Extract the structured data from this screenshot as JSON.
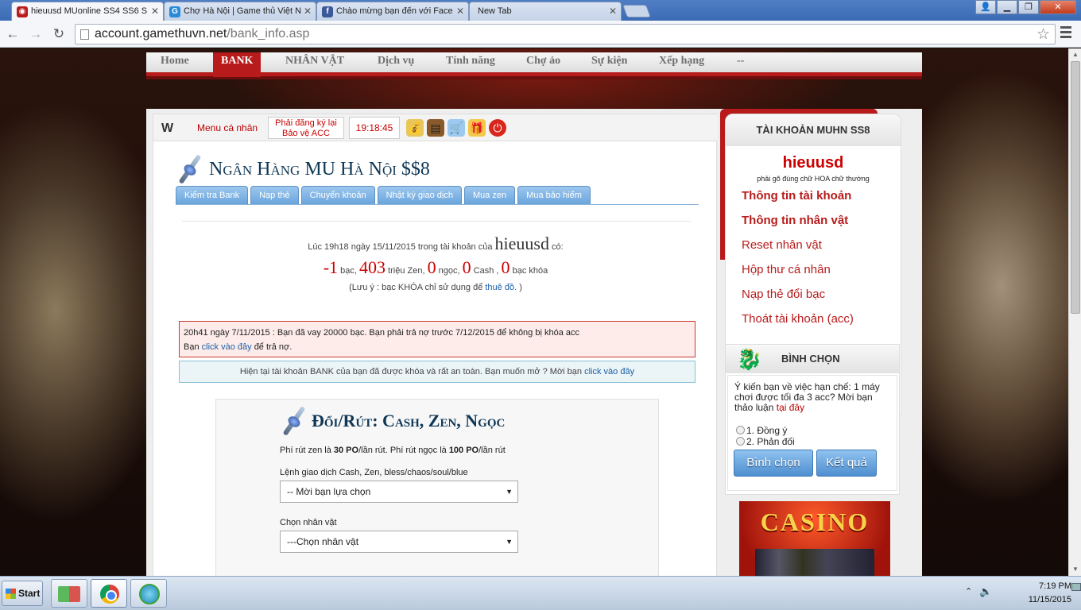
{
  "browser": {
    "tabs": [
      {
        "title": "hieuusd MUonline SS4 SS6 S",
        "icon": "mu-favicon",
        "color": "#b81b1b"
      },
      {
        "title": "Chợ Hà Nội | Game thủ Việt N",
        "icon": "g-favicon",
        "color": "#2a8ad8"
      },
      {
        "title": "Chào mừng bạn đến với Face",
        "icon": "facebook-favicon",
        "color": "#3b5998"
      },
      {
        "title": "New Tab",
        "icon": "",
        "color": ""
      }
    ],
    "url_host": "account.gamethuvn.net",
    "url_path": "/bank_info.asp"
  },
  "topnav": {
    "items": [
      "Home",
      "BANK",
      "NHÂN VẬT",
      "Dịch vụ",
      "Tính năng",
      "Chợ ảo",
      "Sự kiện",
      "Xếp hạng",
      "--"
    ],
    "active": "BANK"
  },
  "subbar": {
    "logo": "W",
    "menu_label": "Menu cá nhân",
    "register_line1": "Phải đăng ký lại",
    "register_line2": "Bảo vệ ACC",
    "clock": "19:18:45",
    "icons": [
      "money-bag-icon",
      "treasure-chest-icon",
      "cart-icon",
      "gift-icon",
      "power-icon"
    ]
  },
  "bank": {
    "title": "Ngân Hàng MU Hà Nội $$8",
    "tabs": [
      "Kiểm tra Bank",
      "Nạp thẻ",
      "Chuyển khoản",
      "Nhật ký giao dịch",
      "Mua zen",
      "Mua bảo hiểm"
    ],
    "account_prefix": "Lúc 19h18 ngày 15/11/2015 trong tài khoản của",
    "account_name": "hieuusd",
    "account_suffix": "có:",
    "balance": {
      "bac": "-1",
      "bac_label": "bạc,",
      "zen": "403",
      "zen_label": "triệu Zen,",
      "ngoc": "0",
      "ngoc_label": "ngọc,",
      "cash": "0",
      "cash_label": "Cash ,",
      "bac_khoa": "0",
      "bac_khoa_label": "bạc khóa"
    },
    "note_prefix": "(Lưu ý : bạc KHÓA chỉ sử dụng để",
    "note_link": "thuê đồ.",
    "note_suffix": ")",
    "warning_line1": "20h41 ngày 7/11/2015 : Bạn đã vay 20000 bạc. Bạn phải trả nợ trước 7/12/2015 để không bị khóa acc",
    "warning_prefix": "Bạn",
    "warning_link": "click vào đây",
    "warning_suffix": "để trả nợ.",
    "info_text": "Hiện tại tài khoản BANK của bạn đã được khóa và rất an toàn. Bạn muốn mở ? Mời bạn",
    "info_link": "click vào đây"
  },
  "withdraw": {
    "title": "Đổi/Rút: Cash, Zen, Ngọc",
    "fee_prefix": "Phí rút zen là",
    "fee_zen": "30 PO",
    "fee_mid": "/lần rút. Phí rút ngọc là",
    "fee_ngoc": "100 PO",
    "fee_suffix": "/lần rút",
    "command_label": "Lệnh giao dịch Cash, Zen, bless/chaos/soul/blue",
    "command_value": "-- Mời bạn lựa chọn",
    "char_label": "Chọn nhân vật",
    "char_value": "---Chọn nhân vật"
  },
  "sidebar": {
    "title": "TÀI KHOẢN MUHN SS8",
    "username": "hieuusd",
    "hint": "phải gõ đúng chữ HOA chữ thường",
    "links": [
      "Thông tin tài khoản",
      "Thông tin nhân vật",
      "Reset nhân vật",
      "Hộp thư cá nhân",
      "Nạp thẻ đổi bạc",
      "Thoát tài khoản (acc)"
    ],
    "vote_title": "BÌNH CHỌN",
    "vote_question": "Ý kiến bạn về việc hạn chế: 1 máy chơi được tối đa 3 acc? Mời bạn thảo luận",
    "vote_link": "tại đây",
    "vote_options": [
      "1. Đồng ý",
      "2. Phản đối"
    ],
    "vote_button": "Bình chọn",
    "result_button": "Kết quả",
    "casino_text": "CASINO"
  },
  "taskbar": {
    "start": "Start",
    "time": "7:19 PM",
    "date": "11/15/2015"
  }
}
